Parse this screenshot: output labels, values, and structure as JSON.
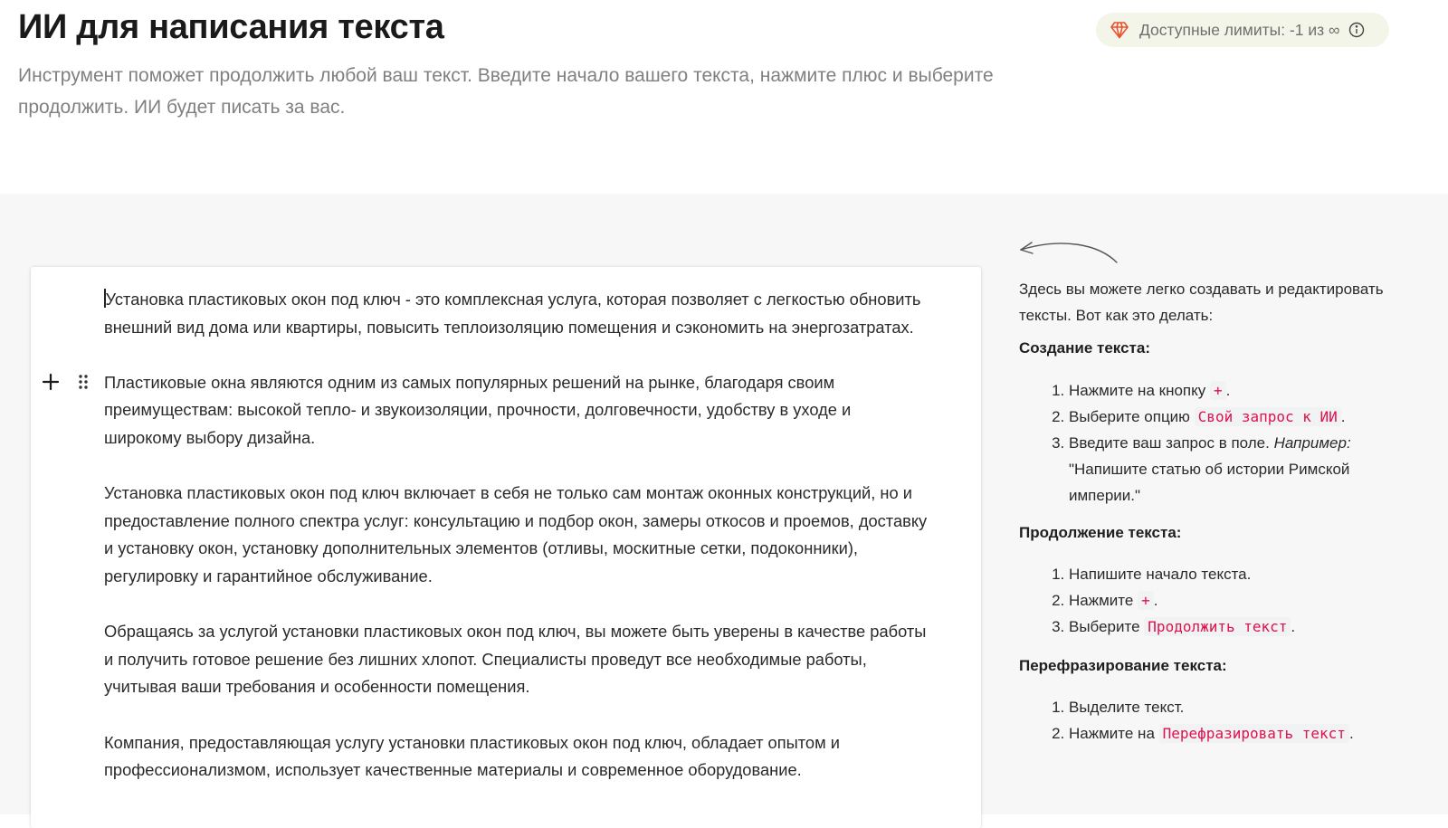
{
  "header": {
    "title": "ИИ для написания текста",
    "subtitle": "Инструмент поможет продолжить любой ваш текст. Введите начало вашего текста, нажмите плюс и выберите продолжить. ИИ будет писать за вас.",
    "limits_label": "Доступные лимиты: -1 из ∞",
    "limits_icon": "gem-icon",
    "info_icon": "info-icon",
    "accent_color": "#e8532f",
    "limits_bg": "#f4f5e9"
  },
  "editor": {
    "paragraphs": [
      "Установка пластиковых окон под ключ - это комплексная услуга, которая позволяет с легкостью обновить внешний вид дома или квартиры, повысить теплоизоляцию помещения и сэкономить на энергозатратах.",
      "Пластиковые окна являются одним из самых популярных решений на рынке, благодаря своим преимуществам: высокой тепло- и звукоизоляции, прочности, долговечности, удобству в уходе и широкому выбору дизайна.",
      "Установка пластиковых окон под ключ включает в себя не только сам монтаж оконных конструкций, но и предоставление полного спектра услуг: консультацию и подбор окон, замеры откосов и проемов, доставку и установку окон, установку дополнительных элементов (отливы, москитные сетки, подоконники), регулировку и гарантийное обслуживание.",
      "Обращаясь за услугой установки пластиковых окон под ключ, вы можете быть уверены в качестве работы и получить готовое решение без лишних хлопот. Специалисты проведут все необходимые работы, учитывая ваши требования и особенности помещения.",
      "Компания, предоставляющая услугу установки пластиковых окон под ключ, обладает опытом и профессионализмом, использует качественные материалы и современное оборудование."
    ],
    "plus_icon": "plus-icon",
    "drag_icon": "drag-handle-icon"
  },
  "help": {
    "intro": "Здесь вы можете легко создавать и редактировать тексты. Вот как это делать:",
    "create": {
      "heading": "Создание текста:",
      "step1_text": "Нажмите на кнопку",
      "step1_code": "+",
      "step1_end": ".",
      "step2_text": "Выберите опцию",
      "step2_code": "Свой запрос к ИИ",
      "step2_end": ".",
      "step3_text": "Введите ваш запрос в поле.",
      "step3_em": "Например:",
      "step3_example": "\"Напишите статью об истории Римской империи.\""
    },
    "continue": {
      "heading": "Продолжение текста:",
      "step1_text": "Напишите начало текста.",
      "step2_text": "Нажмите",
      "step2_code": "+",
      "step2_end": ".",
      "step3_text": "Выберите",
      "step3_code": "Продолжить текст",
      "step3_end": "."
    },
    "rephrase": {
      "heading": "Перефразирование текста:",
      "step1_text": "Выделите текст.",
      "step2_text": "Нажмите на",
      "step2_code": "Перефразировать текст",
      "step2_end": "."
    },
    "code_color": "#e0114c"
  }
}
